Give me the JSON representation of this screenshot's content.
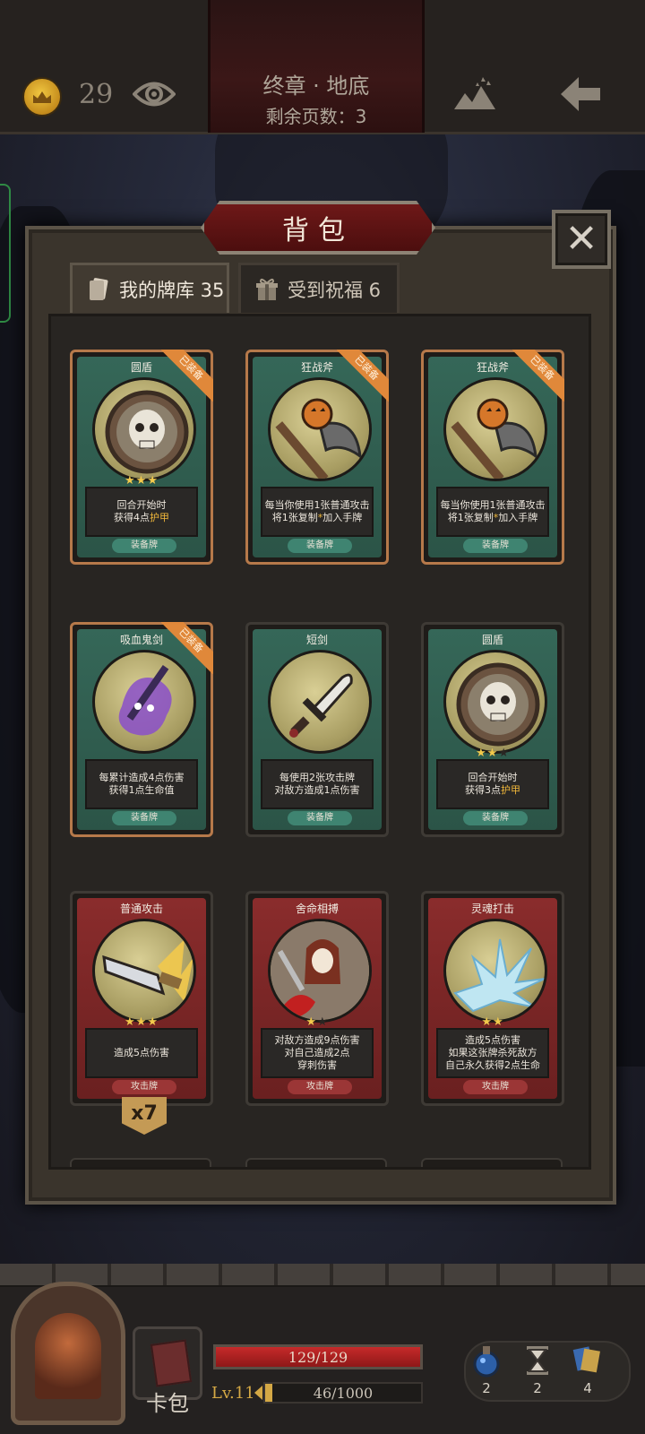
{
  "topbar": {
    "coins": "29",
    "chapter": "终章 · 地底",
    "pages_remaining": "剩余页数：3"
  },
  "backpack": {
    "title": "背包",
    "tabs": [
      {
        "label": "我的牌库 35"
      },
      {
        "label": "受到祝福 6"
      }
    ],
    "equipped_label": "已装备",
    "cards": [
      {
        "name": "圆盾",
        "stars": 3,
        "max_stars": 3,
        "desc_pre": "回合开始时",
        "desc_line2_pre": "获得4点",
        "desc_hl": "护甲",
        "type": "装备牌",
        "equipped": true
      },
      {
        "name": "狂战斧",
        "stars": 0,
        "max_stars": 0,
        "desc1": "每当你使用1张普通攻击",
        "desc2_pre": "将1张复制",
        "desc2_hl": "*",
        "desc2_post": "加入手牌",
        "type": "装备牌",
        "equipped": true
      },
      {
        "name": "狂战斧",
        "stars": 0,
        "max_stars": 0,
        "desc1": "每当你使用1张普通攻击",
        "desc2_pre": "将1张复制",
        "desc2_hl": "*",
        "desc2_post": "加入手牌",
        "type": "装备牌",
        "equipped": true
      },
      {
        "name": "吸血鬼剑",
        "desc1": "每累计造成4点伤害",
        "desc2": "获得1点生命值",
        "type": "装备牌",
        "equipped": true
      },
      {
        "name": "短剑",
        "desc1": "每使用2张攻击牌",
        "desc2": "对敌方造成1点伤害",
        "type": "装备牌",
        "equipped": false
      },
      {
        "name": "圆盾",
        "stars": 2,
        "max_stars": 3,
        "desc_pre": "回合开始时",
        "desc_line2_pre": "获得3点",
        "desc_hl": "护甲",
        "type": "装备牌",
        "equipped": false
      },
      {
        "name": "普通攻击",
        "stars": 3,
        "max_stars": 3,
        "desc1": "造成5点伤害",
        "type": "攻击牌",
        "count": "x7"
      },
      {
        "name": "舍命相搏",
        "stars": 1,
        "max_stars": 2,
        "desc1": "对敌方造成9点伤害",
        "desc2": "对自己造成2点",
        "desc3": "穿刺伤害",
        "type": "攻击牌"
      },
      {
        "name": "灵魂打击",
        "stars": 2,
        "max_stars": 2,
        "desc1": "造成5点伤害",
        "desc2": "如果这张牌杀死敌方",
        "desc3": "自己永久获得2点生命",
        "type": "攻击牌"
      }
    ]
  },
  "bottombar": {
    "bag_label": "卡包",
    "hp_text": "129/129",
    "hp_fraction": 1.0,
    "level": "Lv.11",
    "xp_text": "46/1000",
    "xp_fraction": 0.046,
    "items": [
      {
        "icon": "potion-icon",
        "count": "2"
      },
      {
        "icon": "hourglass-icon",
        "count": "2"
      },
      {
        "icon": "cards-icon",
        "count": "4"
      }
    ]
  },
  "colors": {
    "equip_frame": "#356758",
    "attack_frame": "#8a2c2c",
    "equipped_ribbon": "#e0883a",
    "highlight": "#f1b83a",
    "hp_red": "#c62a2a",
    "xp_gold": "#d4a845"
  }
}
